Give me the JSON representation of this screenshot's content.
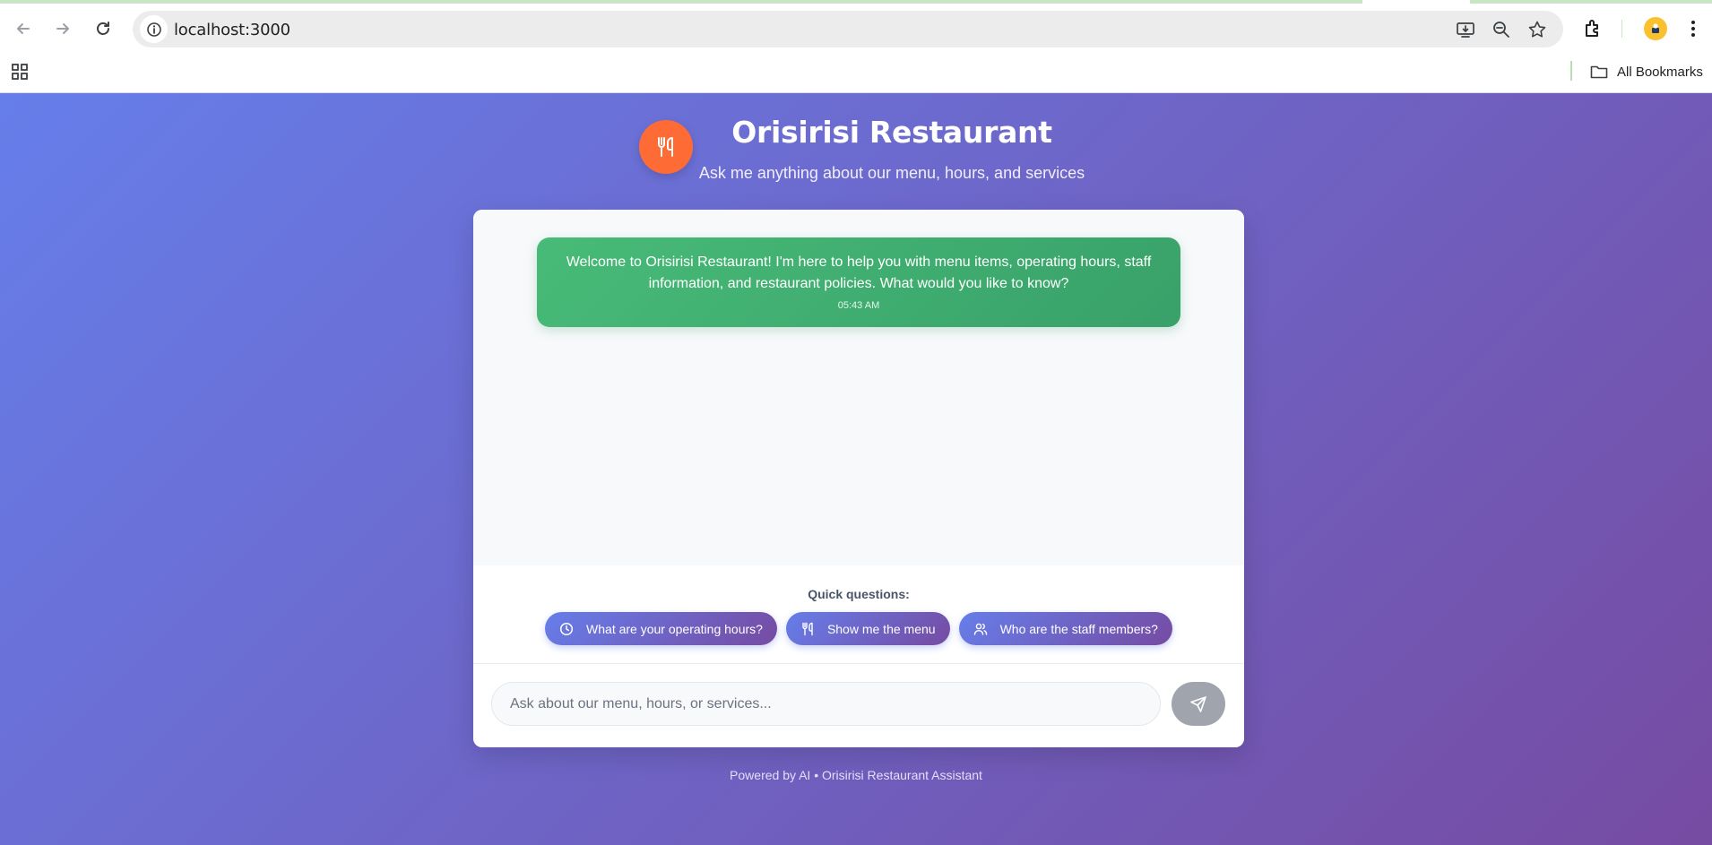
{
  "browser": {
    "url": "localhost:3000",
    "bookmarks_label": "All Bookmarks"
  },
  "header": {
    "title": "Orisirisi Restaurant",
    "subtitle": "Ask me anything about our menu, hours, and services"
  },
  "chat": {
    "messages": [
      {
        "text": "Welcome to Orisirisi Restaurant! I'm here to help you with menu items, operating hours, staff information, and restaurant policies. What would you like to know?",
        "time": "05:43 AM"
      }
    ]
  },
  "quick_questions": {
    "label": "Quick questions:",
    "items": [
      {
        "label": "What are your operating hours?",
        "icon": "clock-icon"
      },
      {
        "label": "Show me the menu",
        "icon": "utensils-icon"
      },
      {
        "label": "Who are the staff members?",
        "icon": "users-icon"
      }
    ]
  },
  "input": {
    "placeholder": "Ask about our menu, hours, or services...",
    "value": ""
  },
  "footer": {
    "text": "Powered by AI • Orisirisi Restaurant Assistant"
  },
  "colors": {
    "gradient_start": "#667eea",
    "gradient_end": "#764ba2",
    "logo": "#ff6b35",
    "bot_bubble": "#48bb78",
    "send_button": "#a0a5ad"
  }
}
